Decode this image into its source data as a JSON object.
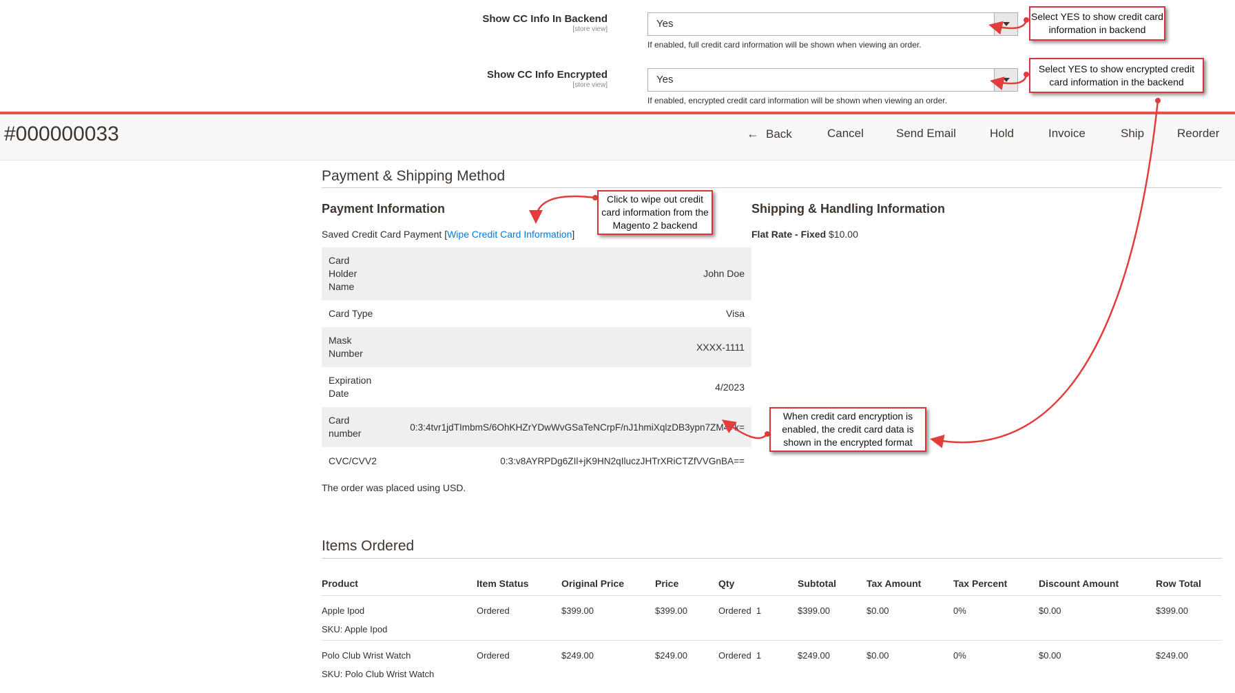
{
  "config": {
    "backend": {
      "label": "Show CC Info In Backend",
      "scope": "[store view]",
      "value": "Yes",
      "note": "If enabled, full credit card information will be shown when viewing an order."
    },
    "encrypted": {
      "label": "Show CC Info Encrypted",
      "scope": "[store view]",
      "value": "Yes",
      "note": "If enabled, encrypted credit card information will be shown when viewing an order."
    }
  },
  "header": {
    "order_number": "#000000033",
    "actions": {
      "back": "Back",
      "cancel": "Cancel",
      "send_email": "Send Email",
      "hold": "Hold",
      "invoice": "Invoice",
      "ship": "Ship",
      "reorder": "Reorder"
    }
  },
  "payment_shipping": {
    "title": "Payment & Shipping Method",
    "payment_title": "Payment Information",
    "saved_cc_prefix": "Saved Credit Card Payment [",
    "wipe_link": "Wipe Credit Card Information",
    "saved_cc_suffix": "]",
    "cc_rows": [
      {
        "key": "Card Holder Name",
        "value": "John Doe"
      },
      {
        "key": "Card Type",
        "value": "Visa"
      },
      {
        "key": "Mask Number",
        "value": "XXXX-1111"
      },
      {
        "key": "Expiration Date",
        "value": "4/2023"
      },
      {
        "key": "Card number",
        "value": "0:3:4tvr1jdTImbmS/6OhKHZrYDwWvGSaTeNCrpF/nJ1hmiXqlzDB3ypn7ZM4+k="
      },
      {
        "key": "CVC/CVV2",
        "value": "0:3:v8AYRPDg6ZIl+jK9HN2qIluczJHTrXRiCTZfVVGnBA=="
      }
    ],
    "currency_note": "The order was placed using USD.",
    "shipping_title": "Shipping & Handling Information",
    "shipping_method": "Flat Rate - Fixed",
    "shipping_price": "$10.00"
  },
  "items": {
    "title": "Items Ordered",
    "columns": [
      "Product",
      "Item Status",
      "Original Price",
      "Price",
      "Qty",
      "Subtotal",
      "Tax Amount",
      "Tax Percent",
      "Discount Amount",
      "Row Total"
    ],
    "rows": [
      {
        "product": "Apple Ipod",
        "sku": "SKU: Apple Ipod",
        "status": "Ordered",
        "original_price": "$399.00",
        "price": "$399.00",
        "qty": "Ordered  1",
        "subtotal": "$399.00",
        "tax_amount": "$0.00",
        "tax_percent": "0%",
        "discount": "$0.00",
        "row_total": "$399.00"
      },
      {
        "product": "Polo Club Wrist Watch",
        "sku": "SKU: Polo Club Wrist Watch",
        "status": "Ordered",
        "original_price": "$249.00",
        "price": "$249.00",
        "qty": "Ordered  1",
        "subtotal": "$249.00",
        "tax_amount": "$0.00",
        "tax_percent": "0%",
        "discount": "$0.00",
        "row_total": "$249.00"
      }
    ]
  },
  "callouts": {
    "show_cc": "Select YES to show credit card information in backend",
    "show_encrypted": "Select YES to show encrypted credit card information in the backend",
    "wipe": "Click to wipe out credit card information from the Magento 2 backend",
    "encrypted_format": "When credit card encryption is enabled, the credit card data is shown in the encrypted format"
  },
  "colors": {
    "accent_red": "#eb4f4b",
    "link_blue": "#007bdb",
    "callout_border": "#d7353a"
  }
}
